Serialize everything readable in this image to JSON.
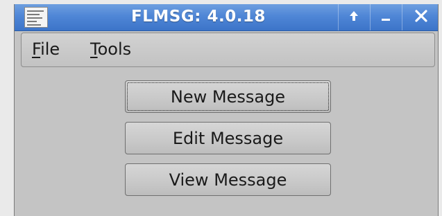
{
  "window": {
    "title": "FLMSG: 4.0.18",
    "controls": {
      "up_glyph": "↑",
      "minimize_glyph": "–",
      "close_glyph": "✕"
    },
    "app_icon": "document-icon"
  },
  "menubar": {
    "file": {
      "mnemonic": "F",
      "rest": "ile"
    },
    "tools": {
      "mnemonic": "T",
      "rest": "ools"
    }
  },
  "buttons": {
    "new_message": "New Message",
    "edit_message": "Edit Message",
    "view_message": "View Message"
  },
  "colors": {
    "titlebar": "#4f86d6",
    "window_bg": "#c4c4c4"
  }
}
